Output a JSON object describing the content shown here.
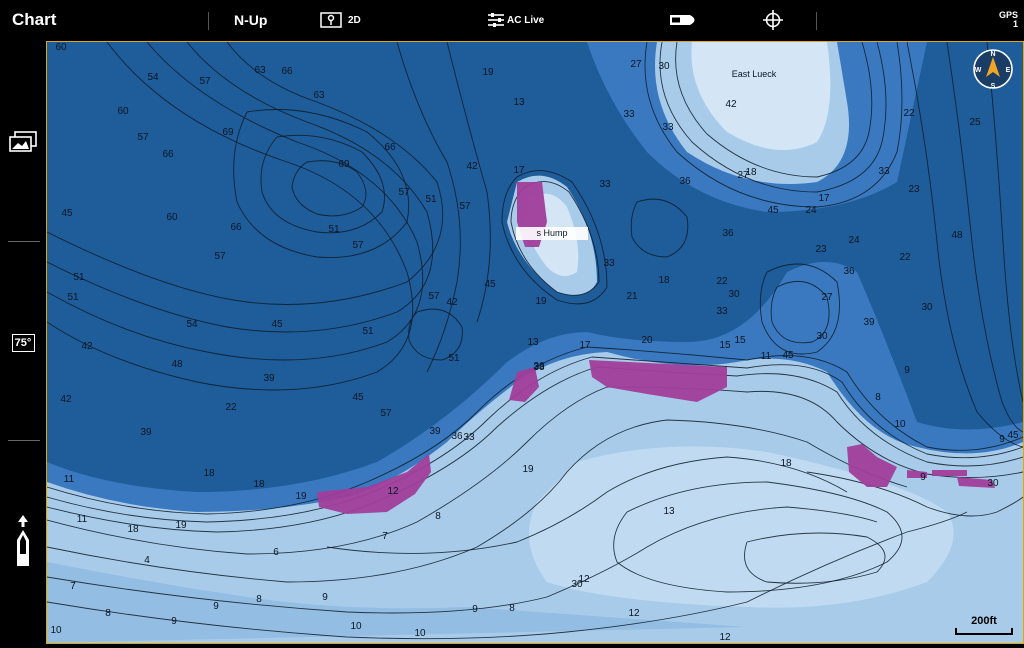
{
  "topbar": {
    "title": "Chart",
    "orientation": "N-Up",
    "view_mode": "2D",
    "ac_live": "AC Live",
    "gps_label": "GPS",
    "gps_value": "1"
  },
  "sidebar": {
    "water_temp": "75°"
  },
  "map": {
    "place_labels": [
      "East Lueck",
      "s Hump"
    ],
    "scale_label": "200ft",
    "compass_letters": [
      "N",
      "E",
      "S",
      "W"
    ],
    "colors": {
      "deep": "#1f5c9a",
      "mid": "#3a79c0",
      "shallow": "#a8cbea",
      "shoal": "#d4e6f6",
      "highlight": "#a03d9a",
      "contour": "#0d1a26"
    },
    "depth_labels": [
      "60",
      "54",
      "57",
      "63",
      "66",
      "60",
      "57",
      "66",
      "69",
      "63",
      "66",
      "69",
      "57",
      "51",
      "60",
      "57",
      "66",
      "51",
      "57",
      "45",
      "51",
      "51",
      "54",
      "42",
      "48",
      "45",
      "39",
      "42",
      "39",
      "22",
      "18",
      "11",
      "11",
      "18",
      "19",
      "18",
      "19",
      "12",
      "8",
      "7",
      "6",
      "4",
      "7",
      "8",
      "9",
      "10",
      "9",
      "8",
      "9",
      "10",
      "10",
      "9",
      "8",
      "12",
      "12",
      "12",
      "18",
      "19",
      "13",
      "30",
      "33",
      "36",
      "33",
      "36",
      "39",
      "45",
      "42",
      "51",
      "57",
      "51",
      "45",
      "57",
      "42",
      "57",
      "13",
      "17",
      "19",
      "27",
      "30",
      "33",
      "33",
      "36",
      "33",
      "36",
      "18",
      "22",
      "15",
      "30",
      "33",
      "21",
      "33",
      "19",
      "13",
      "17",
      "20",
      "15",
      "11",
      "42",
      "24",
      "27",
      "45",
      "18",
      "22",
      "23",
      "25",
      "17",
      "24",
      "23",
      "27",
      "30",
      "45",
      "39",
      "36",
      "33",
      "22",
      "48",
      "30",
      "9",
      "8",
      "10",
      "9",
      "45",
      "30",
      "9"
    ]
  }
}
